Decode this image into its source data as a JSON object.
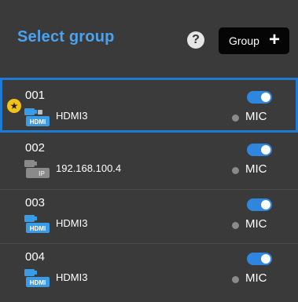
{
  "header": {
    "title": "Select group",
    "help_label": "?",
    "group_button_label": "Group",
    "group_button_plus": "+"
  },
  "groups": [
    {
      "name": "001",
      "source": "HDMI3",
      "source_type": "hdmi",
      "favorite": true,
      "selected": true,
      "enabled": true,
      "mic_label": "MIC"
    },
    {
      "name": "002",
      "source": "192.168.100.4",
      "source_type": "ip",
      "favorite": false,
      "selected": false,
      "enabled": true,
      "mic_label": "MIC"
    },
    {
      "name": "003",
      "source": "HDMI3",
      "source_type": "hdmi",
      "favorite": false,
      "selected": false,
      "enabled": true,
      "mic_label": "MIC"
    },
    {
      "name": "004",
      "source": "HDMI3",
      "source_type": "hdmi",
      "favorite": false,
      "selected": false,
      "enabled": true,
      "mic_label": "MIC"
    }
  ],
  "icons": {
    "favorite": "star-icon",
    "hdmi_camera": "hdmi-camera-icon",
    "ip_camera": "ip-camera-icon",
    "help": "question-icon",
    "add": "plus-icon",
    "mic_status": "dot-icon"
  },
  "colors": {
    "accent": "#1e7bd1",
    "title": "#4aa3f0",
    "toggle_on": "#2e86de",
    "star": "#f3c21a",
    "mic_dot": "#8a8a8a"
  }
}
